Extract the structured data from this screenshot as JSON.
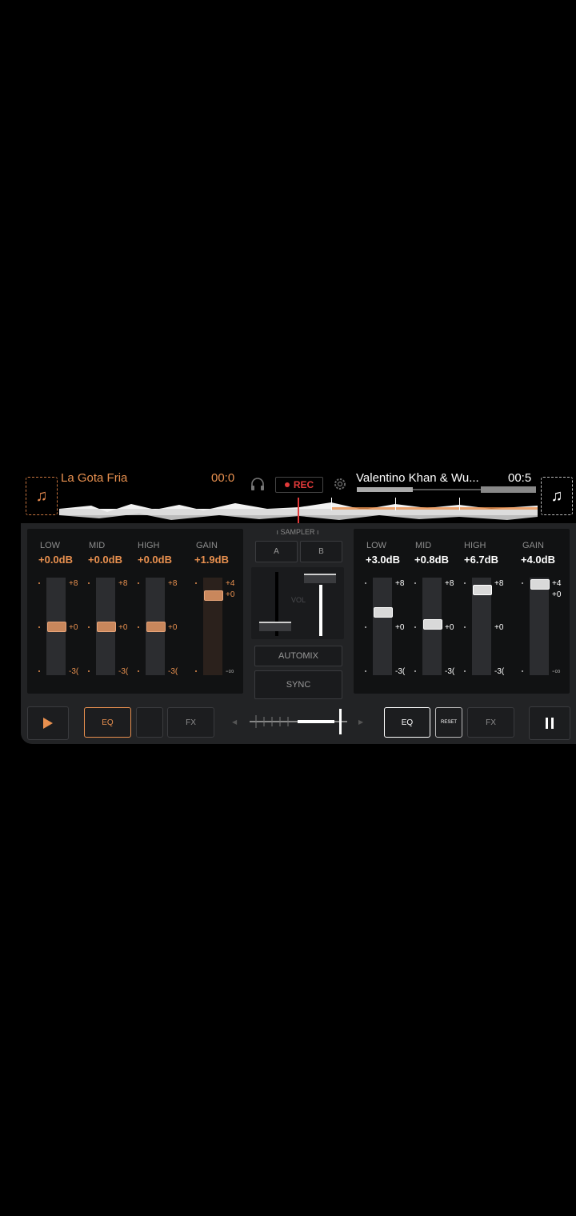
{
  "deck_left": {
    "track_title": "La Gota Fria",
    "time": "00:0",
    "eq": {
      "labels": [
        "LOW",
        "MID",
        "HIGH",
        "GAIN"
      ],
      "values": [
        "+0.0dB",
        "+0.0dB",
        "+0.0dB",
        "+1.9dB"
      ],
      "scale_top": "+8",
      "scale_mid": "+0",
      "scale_bottom": "-3(",
      "gain_top": "+4",
      "gain_mid": "+0",
      "gain_bottom": "-∞",
      "band_levels": [
        0.5,
        0.5,
        0.5
      ],
      "gain_level": 0.87
    },
    "buttons": {
      "eq": "EQ",
      "fx": "FX"
    }
  },
  "deck_right": {
    "track_title": "Valentino Khan & Wu...",
    "time": "00:5",
    "eq": {
      "labels": [
        "LOW",
        "MID",
        "HIGH",
        "GAIN"
      ],
      "values": [
        "+3.0dB",
        "+0.8dB",
        "+6.7dB",
        "+4.0dB"
      ],
      "scale_top": "+8",
      "scale_mid": "+0",
      "scale_bottom": "-3(",
      "gain_top": "+4",
      "gain_mid": "+0",
      "gain_bottom": "-∞",
      "band_levels": [
        0.66,
        0.53,
        0.92
      ],
      "gain_level": 1.0
    },
    "buttons": {
      "eq": "EQ",
      "reset": "RESET",
      "fx": "FX"
    }
  },
  "center": {
    "rec_label": "REC",
    "sampler_label": "SAMPLER",
    "sampler_a": "A",
    "sampler_b": "B",
    "vol_label": "VOL",
    "automix": "AUTOMIX",
    "sync": "SYNC"
  },
  "colors": {
    "accent_left": "#e8904f",
    "accent_right": "#ffffff",
    "rec": "#e23a3a"
  }
}
